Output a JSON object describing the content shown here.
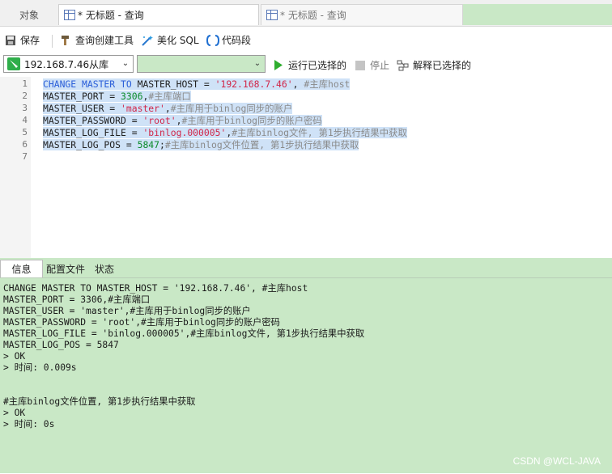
{
  "tabs": {
    "objects": "对象",
    "query1": "* 无标题 - 查询",
    "query2": "* 无标题 - 查询"
  },
  "toolbar": {
    "save": "保存",
    "query_builder": "查询创建工具",
    "beautify": "美化 SQL",
    "snippet": "代码段"
  },
  "connection": {
    "server": "192.168.7.46从库",
    "database": "",
    "run_selected": "运行已选择的",
    "stop": "停止",
    "explain_selected": "解释已选择的"
  },
  "editor": {
    "line_numbers": [
      "1",
      "2",
      "3",
      "4",
      "5",
      "6",
      "7"
    ],
    "lines": [
      [
        {
          "t": "CHANGE MASTER TO",
          "c": "kw"
        },
        {
          "t": " MASTER_HOST = ",
          "c": "pl"
        },
        {
          "t": "'192.168.7.46'",
          "c": "str"
        },
        {
          "t": ", ",
          "c": "pl"
        },
        {
          "t": "#主库host",
          "c": "cm"
        }
      ],
      [
        {
          "t": "MASTER_PORT = ",
          "c": "pl"
        },
        {
          "t": "3306",
          "c": "num"
        },
        {
          "t": ",",
          "c": "pl"
        },
        {
          "t": "#主库端口",
          "c": "cm"
        }
      ],
      [
        {
          "t": "MASTER_USER = ",
          "c": "pl"
        },
        {
          "t": "'master'",
          "c": "str"
        },
        {
          "t": ",",
          "c": "pl"
        },
        {
          "t": "#主库用于binlog同步的账户",
          "c": "cm"
        }
      ],
      [
        {
          "t": "MASTER_PASSWORD = ",
          "c": "pl"
        },
        {
          "t": "'root'",
          "c": "str"
        },
        {
          "t": ",",
          "c": "pl"
        },
        {
          "t": "#主库用于binlog同步的账户密码",
          "c": "cm"
        }
      ],
      [
        {
          "t": "MASTER_LOG_FILE = ",
          "c": "pl"
        },
        {
          "t": "'binlog.000005'",
          "c": "str"
        },
        {
          "t": ",",
          "c": "pl"
        },
        {
          "t": "#主库binlog文件, 第1步执行结果中获取",
          "c": "cm"
        }
      ],
      [
        {
          "t": "MASTER_LOG_POS = ",
          "c": "pl"
        },
        {
          "t": "5847",
          "c": "num"
        },
        {
          "t": ";",
          "c": "pl"
        },
        {
          "t": "#主库binlog文件位置, 第1步执行结果中获取",
          "c": "cm"
        }
      ]
    ]
  },
  "result_tabs": {
    "info": "信息",
    "profile": "配置文件",
    "status": "状态"
  },
  "output": {
    "lines": [
      "CHANGE MASTER TO MASTER_HOST = '192.168.7.46', #主库host",
      "MASTER_PORT = 3306,#主库端口",
      "MASTER_USER = 'master',#主库用于binlog同步的账户",
      "MASTER_PASSWORD = 'root',#主库用于binlog同步的账户密码",
      "MASTER_LOG_FILE = 'binlog.000005',#主库binlog文件, 第1步执行结果中获取",
      "MASTER_LOG_POS = 5847",
      "> OK",
      "> 时间: 0.009s",
      "",
      "",
      "#主库binlog文件位置, 第1步执行结果中获取",
      "> OK",
      "> 时间: 0s"
    ]
  },
  "watermark": "CSDN @WCL-JAVA",
  "colors": {
    "keyword": "#2b5fd9",
    "string": "#d1274a",
    "number": "#0b8a2a",
    "comment": "#8a8a8a",
    "selection": "#cfe2f7",
    "panel_green": "#c9e8c6",
    "run_green": "#2fae2f"
  },
  "icons": [
    "save-icon",
    "hammer-icon",
    "wand-icon",
    "braces-icon",
    "connection-icon",
    "play-icon",
    "stop-icon",
    "explain-icon",
    "query-table-icon"
  ]
}
